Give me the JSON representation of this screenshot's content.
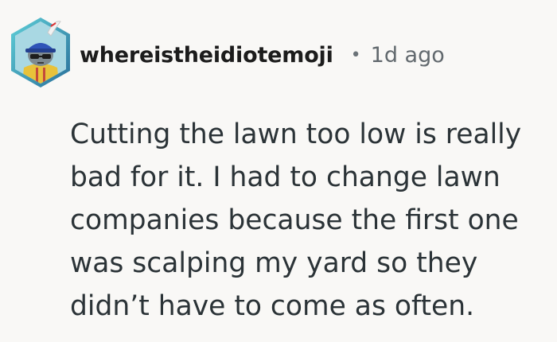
{
  "comment": {
    "author": "whereistheidiotemoji",
    "separator": "•",
    "time_ago": "1d ago",
    "body_lines": [
      "Cutting the lawn too low is really",
      "bad for it. I had to change lawn",
      "companies because the first one",
      "was scalping my yard so they",
      "didn’t have to come as often."
    ]
  },
  "colors": {
    "background": "#f9f8f6",
    "text": "#2b3337",
    "avatar_frame": "#3ab7c9",
    "avatar_frame_dark": "#2a6f9a"
  },
  "icons": {
    "avatar": "user-avatar-hexagon"
  }
}
